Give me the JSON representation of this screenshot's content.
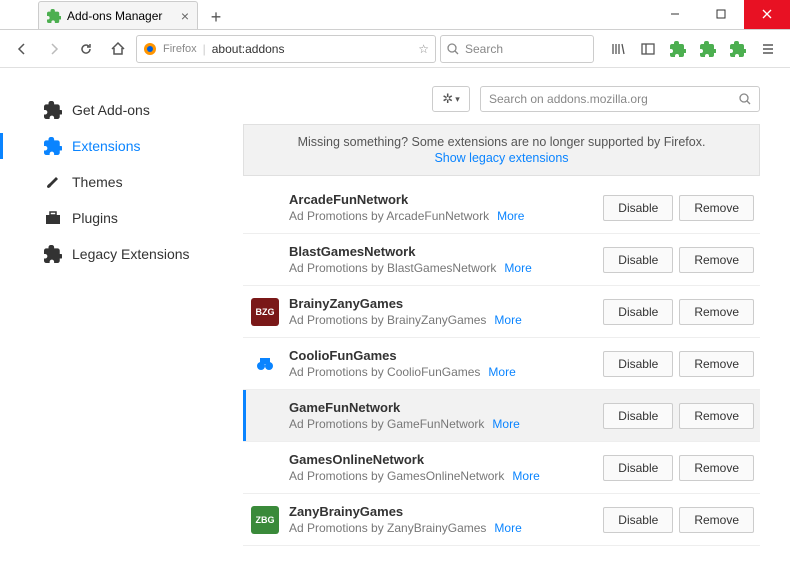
{
  "window": {
    "tab_title": "Add-ons Manager",
    "minimize": "—",
    "maximize": "□",
    "close": "×"
  },
  "toolbar": {
    "firefox_label": "Firefox",
    "url": "about:addons",
    "search_placeholder": "Search"
  },
  "sidebar": {
    "items": [
      {
        "label": "Get Add-ons"
      },
      {
        "label": "Extensions"
      },
      {
        "label": "Themes"
      },
      {
        "label": "Plugins"
      },
      {
        "label": "Legacy Extensions"
      }
    ]
  },
  "main": {
    "search_placeholder": "Search on addons.mozilla.org",
    "notice_text": "Missing something? Some extensions are no longer supported by Firefox.",
    "notice_link": "Show legacy extensions",
    "disable_label": "Disable",
    "remove_label": "Remove",
    "more_label": "More",
    "extensions": [
      {
        "name": "ArcadeFunNetwork",
        "desc": "Ad Promotions by ArcadeFunNetwork",
        "icon_bg": "",
        "icon_text": ""
      },
      {
        "name": "BlastGamesNetwork",
        "desc": "Ad Promotions by BlastGamesNetwork",
        "icon_bg": "",
        "icon_text": ""
      },
      {
        "name": "BrainyZanyGames",
        "desc": "Ad Promotions by BrainyZanyGames",
        "icon_bg": "#7a1818",
        "icon_text": "BZG"
      },
      {
        "name": "CoolioFunGames",
        "desc": "Ad Promotions by CoolioFunGames",
        "icon_bg": "#ffffff",
        "icon_text": ""
      },
      {
        "name": "GameFunNetwork",
        "desc": "Ad Promotions by GameFunNetwork",
        "icon_bg": "",
        "icon_text": ""
      },
      {
        "name": "GamesOnlineNetwork",
        "desc": "Ad Promotions by GamesOnlineNetwork",
        "icon_bg": "",
        "icon_text": ""
      },
      {
        "name": "ZanyBrainyGames",
        "desc": "Ad Promotions by ZanyBrainyGames",
        "icon_bg": "#3a8a3a",
        "icon_text": "ZBG"
      }
    ]
  }
}
